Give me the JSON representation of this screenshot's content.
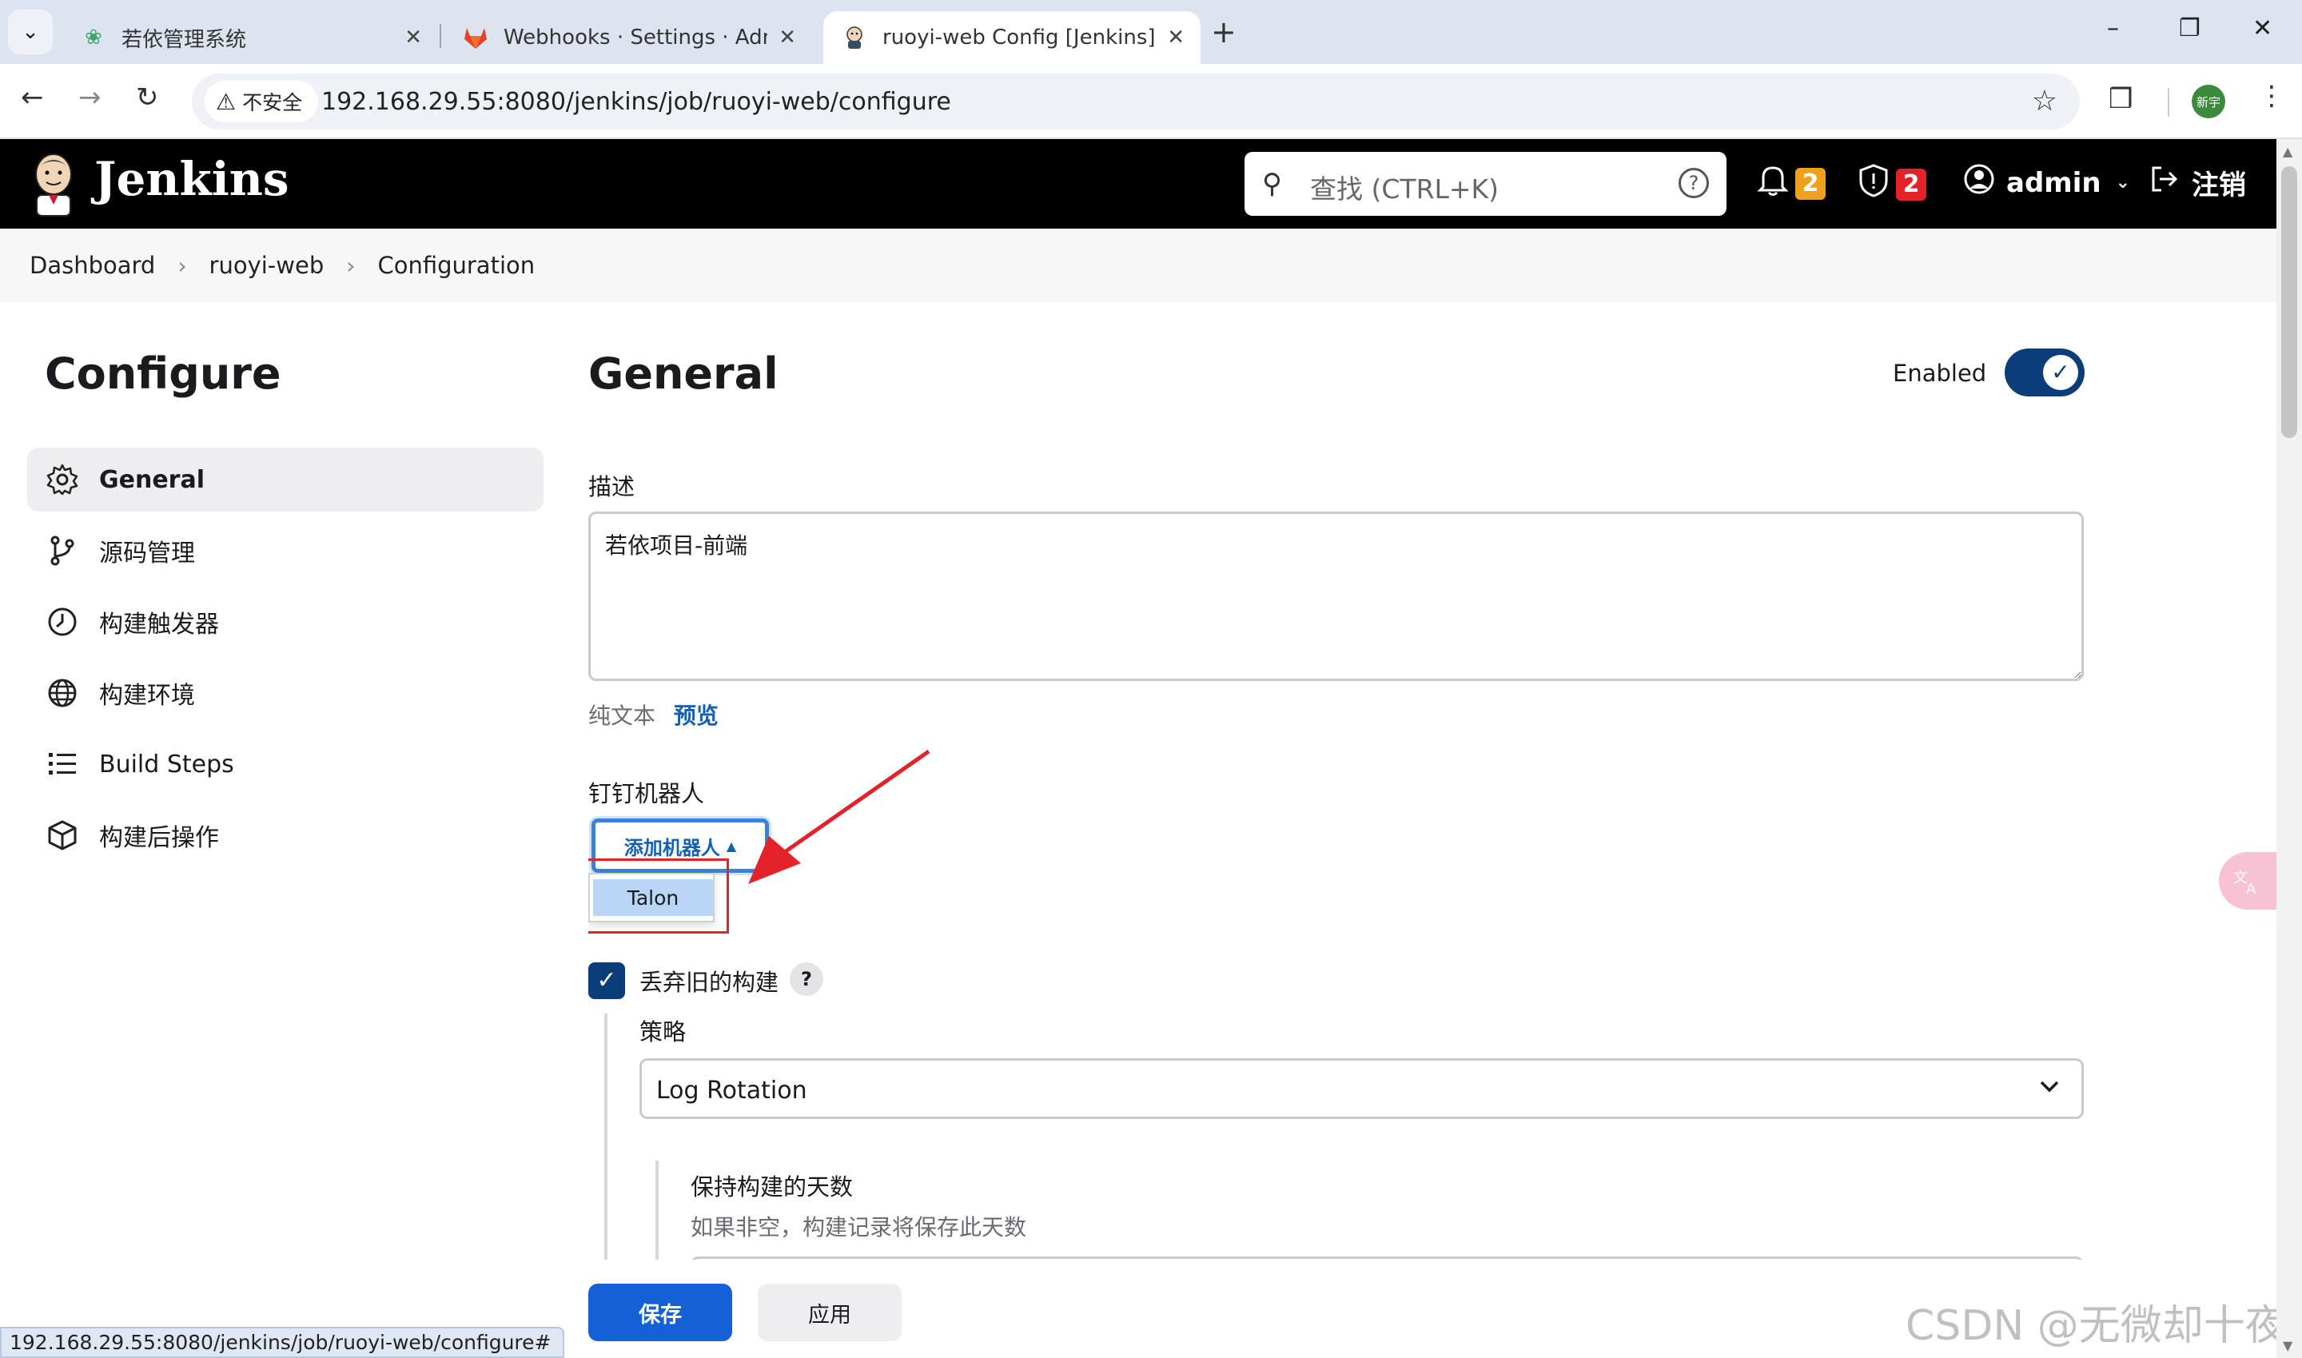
{
  "browser": {
    "tabs": [
      {
        "title": "若依管理系统",
        "favicon": "leaf-icon",
        "active": false
      },
      {
        "title": "Webhooks · Settings · Admin",
        "favicon": "gitlab-icon",
        "active": false
      },
      {
        "title": "ruoyi-web Config [Jenkins]",
        "favicon": "jenkins-icon",
        "active": true
      }
    ],
    "insecure_label": "不安全",
    "url": "192.168.29.55:8080/jenkins/job/ruoyi-web/configure",
    "profile_initials": "新宇"
  },
  "header": {
    "app_name": "Jenkins",
    "search_placeholder": "查找 (CTRL+K)",
    "notifications_count": "2",
    "security_count": "2",
    "user": "admin",
    "logout_label": "注销",
    "colors": {
      "badge_notify": "#f0a01e",
      "badge_security": "#e3222a"
    }
  },
  "breadcrumb": [
    "Dashboard",
    "ruoyi-web",
    "Configuration"
  ],
  "sidebar": {
    "title": "Configure",
    "items": [
      {
        "label": "General",
        "icon": "gear-icon",
        "active": true
      },
      {
        "label": "源码管理",
        "icon": "branch-icon",
        "active": false
      },
      {
        "label": "构建触发器",
        "icon": "clock-icon",
        "active": false
      },
      {
        "label": "构建环境",
        "icon": "globe-icon",
        "active": false
      },
      {
        "label": "Build Steps",
        "icon": "list-icon",
        "active": false
      },
      {
        "label": "构建后操作",
        "icon": "cube-icon",
        "active": false
      }
    ]
  },
  "general": {
    "title": "General",
    "enabled_label": "Enabled",
    "enabled": true,
    "description_label": "描述",
    "description_value": "若依项目-前端",
    "text_format": "纯文本",
    "preview_label": "预览",
    "dingtalk_label": "钉钉机器人",
    "add_robot_button": "添加机器人",
    "dropdown_options": [
      "Talon"
    ],
    "discard_old_builds_label": "丢弃旧的构建",
    "discard_old_builds_checked": true,
    "help_symbol": "?",
    "strategy_label": "策略",
    "strategy_value": "Log Rotation",
    "days_to_keep_label": "保持构建的天数",
    "days_to_keep_help": "如果非空，构建记录将保存此天数"
  },
  "footer": {
    "save_label": "保存",
    "apply_label": "应用"
  },
  "status_url": "192.168.29.55:8080/jenkins/job/ruoyi-web/configure#",
  "watermark": "CSDN @无微却十夜"
}
